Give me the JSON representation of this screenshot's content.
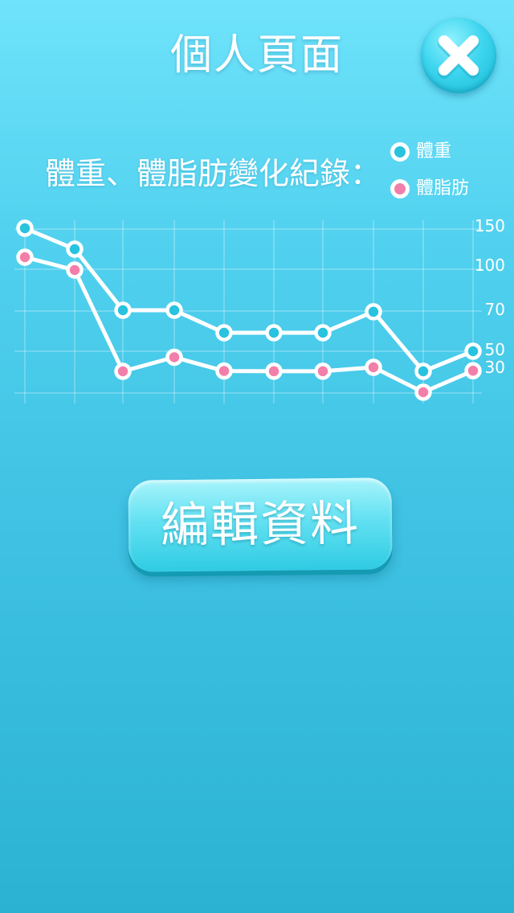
{
  "header": {
    "title": "個人頁面",
    "close_icon": "close-x-icon"
  },
  "section": {
    "title": "體重、體脂肪變化紀錄："
  },
  "legend": [
    {
      "label": "體重",
      "color": "#27c3df"
    },
    {
      "label": "體脂肪",
      "color": "#f27faa"
    }
  ],
  "chart_data": {
    "type": "line",
    "title": "",
    "xlabel": "",
    "ylabel": "",
    "x": [
      1,
      2,
      3,
      4,
      5,
      6,
      7,
      8,
      9,
      10
    ],
    "ytick_labels": [
      "150",
      "100",
      "70",
      "50",
      "30"
    ],
    "grid": true,
    "legend_position": "top-right",
    "series": [
      {
        "name": "體重",
        "color": "#27c3df",
        "values": [
          150,
          130,
          73,
          73,
          58,
          58,
          58,
          72,
          40,
          50
        ]
      },
      {
        "name": "體脂肪",
        "color": "#f27faa",
        "values": [
          122,
          110,
          40,
          47,
          36,
          39,
          39,
          42,
          22,
          33
        ]
      }
    ]
  },
  "actions": {
    "edit_label": "編輯資料"
  }
}
